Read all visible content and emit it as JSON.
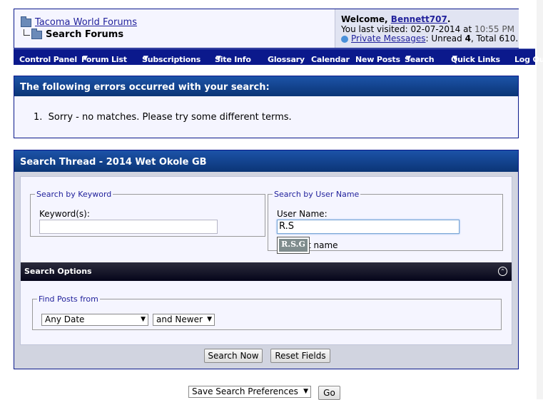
{
  "breadcrumb": {
    "forum_name": "Tacoma World Forums",
    "current_page": "Search Forums"
  },
  "welcome": {
    "prefix": "Welcome, ",
    "username": "Bennett707",
    "suffix": ".",
    "last_visited_label": "You last visited: 02-07-2014 at ",
    "last_visited_time": "10:55 PM",
    "pm_link": "Private Messages",
    "pm_info_prefix": ": Unread ",
    "pm_unread": "4",
    "pm_info_suffix": ", Total 610."
  },
  "navbar": [
    {
      "label": "Control Panel",
      "dropdown": false
    },
    {
      "label": "Forum List",
      "dropdown": true
    },
    {
      "label": "Subscriptions",
      "dropdown": true
    },
    {
      "label": "Site Info",
      "dropdown": true
    },
    {
      "label": "Glossary",
      "dropdown": false
    },
    {
      "label": "Calendar",
      "dropdown": false
    },
    {
      "label": "New Posts",
      "dropdown": false
    },
    {
      "label": "Search",
      "dropdown": true
    },
    {
      "label": "Quick Links",
      "dropdown": true
    },
    {
      "label": "Log Out",
      "dropdown": false
    }
  ],
  "errors": {
    "title": "The following errors occurred with your search:",
    "items": [
      "Sorry - no matches. Please try some different terms."
    ],
    "item_number": "1."
  },
  "search": {
    "title": "Search Thread - 2014 Wet Okole GB",
    "keyword_legend": "Search by Keyword",
    "keyword_label": "Keyword(s):",
    "keyword_value": "",
    "username_legend": "Search by User Name",
    "username_label": "User Name:",
    "username_value": "R.S",
    "autocomplete_suggestion": "R.S.G",
    "exact_name_label": "t name",
    "options_title": "Search Options",
    "find_posts_legend": "Find Posts from",
    "date_select": "Any Date",
    "newer_select": "and Newer",
    "search_button": "Search Now",
    "reset_button": "Reset Fields"
  },
  "footer": {
    "preferences_select": "Save Search Preferences",
    "go_button": "Go"
  },
  "colors": {
    "nav_bg": "#0b198c",
    "header_blue": "#0b3e8c",
    "link": "#22229c"
  }
}
